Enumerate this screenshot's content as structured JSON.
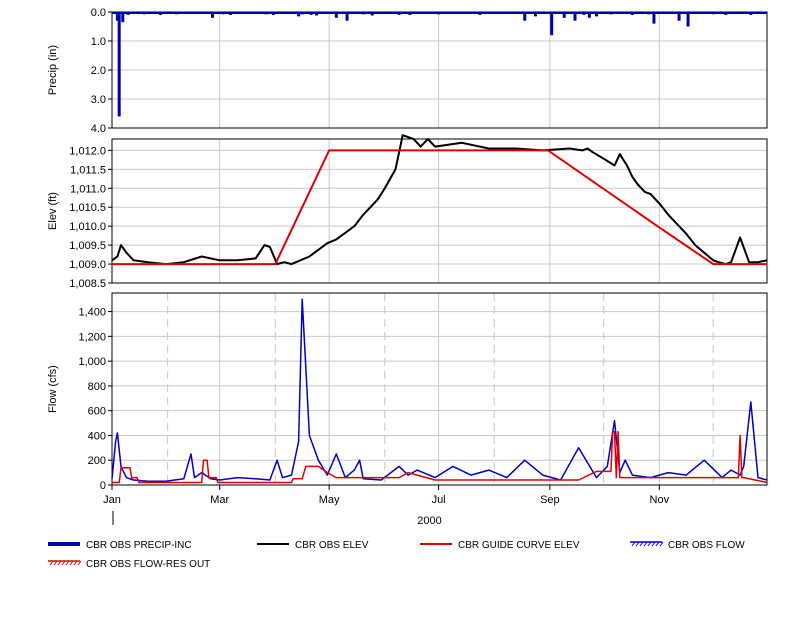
{
  "chart_data": [
    {
      "type": "bar",
      "panel": "precip",
      "ylabel": "Precip (in)",
      "y_inverted": true,
      "ylim": [
        4.0,
        0.0
      ],
      "yticks": [
        "0.0",
        "1.0",
        "2.0",
        "3.0",
        "4.0"
      ],
      "ytick_values": [
        0,
        1,
        2,
        3,
        4
      ],
      "grid": true,
      "series": [
        {
          "name": "CBR OBS PRECIP-INC",
          "color": "#0000a8",
          "x_day_of_year": [
            3,
            4,
            6,
            9,
            14,
            18,
            21,
            24,
            27,
            32,
            36,
            38,
            40,
            44,
            49,
            51,
            56,
            62,
            66,
            70,
            75,
            80,
            86,
            90,
            95,
            101,
            104,
            106,
            111,
            114,
            121,
            125,
            131,
            135,
            140,
            145,
            150,
            155,
            160,
            166,
            171,
            176,
            182,
            187,
            192,
            198,
            205,
            212,
            218,
            225,
            230,
            236,
            240,
            245,
            252,
            258,
            263,
            266,
            270,
            274,
            278,
            282,
            286,
            290,
            294,
            299,
            302,
            306,
            311,
            316,
            321,
            325,
            330,
            335,
            338,
            342,
            347,
            351,
            356,
            360,
            364
          ],
          "values": [
            0.3,
            3.6,
            0.35,
            0.1,
            0.05,
            0.08,
            0.05,
            0.04,
            0.1,
            0.05,
            0.08,
            0.05,
            0.07,
            0.05,
            0.05,
            0.05,
            0.2,
            0.08,
            0.1,
            0.05,
            0.05,
            0.05,
            0.08,
            0.1,
            0.06,
            0.05,
            0.15,
            0.08,
            0.1,
            0.12,
            0.05,
            0.2,
            0.3,
            0.05,
            0.08,
            0.12,
            0.05,
            0.07,
            0.1,
            0.1,
            0.05,
            0.05,
            0.08,
            0.05,
            0.05,
            0.06,
            0.1,
            0.05,
            0.05,
            0.05,
            0.3,
            0.15,
            0.05,
            0.8,
            0.2,
            0.3,
            0.1,
            0.2,
            0.15,
            0.05,
            0.08,
            0.05,
            0.05,
            0.1,
            0.05,
            0.08,
            0.4,
            0.05,
            0.05,
            0.3,
            0.5,
            0.05,
            0.05,
            0.08,
            0.05,
            0.1,
            0.05,
            0.05,
            0.1,
            0.05,
            0.05
          ]
        }
      ]
    },
    {
      "type": "line",
      "panel": "elev",
      "ylabel": "Elev (ft)",
      "ylim": [
        1008.5,
        1012.3
      ],
      "yticks": [
        "1,008.5",
        "1,009.0",
        "1,009.5",
        "1,010.0",
        "1,010.5",
        "1,011.0",
        "1,011.5",
        "1,012.0"
      ],
      "ytick_values": [
        1008.5,
        1009.0,
        1009.5,
        1010.0,
        1010.5,
        1011.0,
        1011.5,
        1012.0
      ],
      "grid": true,
      "series": [
        {
          "name": "CBR OBS ELEV",
          "color": "#000000",
          "x_day_of_year": [
            0,
            3,
            5,
            8,
            12,
            20,
            30,
            40,
            50,
            60,
            70,
            80,
            85,
            88,
            92,
            96,
            100,
            110,
            120,
            125,
            135,
            140,
            148,
            152,
            158,
            162,
            168,
            172,
            176,
            180,
            195,
            210,
            225,
            240,
            255,
            262,
            265,
            268,
            275,
            280,
            283,
            287,
            290,
            293,
            297,
            300,
            305,
            310,
            315,
            320,
            325,
            330,
            335,
            338,
            342,
            345,
            350,
            355,
            360,
            365
          ],
          "values": [
            1009.1,
            1009.2,
            1009.5,
            1009.3,
            1009.1,
            1009.05,
            1009.0,
            1009.05,
            1009.2,
            1009.1,
            1009.1,
            1009.15,
            1009.5,
            1009.45,
            1009.0,
            1009.05,
            1009.0,
            1009.2,
            1009.55,
            1009.65,
            1010.0,
            1010.3,
            1010.7,
            1011.0,
            1011.5,
            1012.4,
            1012.3,
            1012.1,
            1012.3,
            1012.1,
            1012.2,
            1012.05,
            1012.05,
            1012.0,
            1012.05,
            1012.0,
            1012.05,
            1011.95,
            1011.75,
            1011.6,
            1011.9,
            1011.6,
            1011.3,
            1011.1,
            1010.9,
            1010.85,
            1010.6,
            1010.3,
            1010.05,
            1009.8,
            1009.5,
            1009.3,
            1009.1,
            1009.05,
            1009.0,
            1009.05,
            1009.7,
            1009.05,
            1009.05,
            1009.1
          ]
        },
        {
          "name": "CBR GUIDE CURVE ELEV",
          "color": "#e00000",
          "x_day_of_year": [
            0,
            75,
            91,
            121,
            243,
            304,
            335,
            365
          ],
          "values": [
            1009.0,
            1009.0,
            1009.0,
            1012.0,
            1012.0,
            1010.0,
            1009.0,
            1009.0
          ]
        }
      ]
    },
    {
      "type": "line",
      "panel": "flow",
      "ylabel": "Flow (cfs)",
      "ylim": [
        0,
        1550
      ],
      "yticks": [
        "0",
        "200",
        "400",
        "600",
        "800",
        "1,000",
        "1,200",
        "1,400"
      ],
      "ytick_values": [
        0,
        200,
        400,
        600,
        800,
        1000,
        1200,
        1400
      ],
      "grid": true,
      "x_months": [
        "Jan",
        "Mar",
        "May",
        "Jul",
        "Sep",
        "Nov"
      ],
      "x_month_day_of_year": [
        0,
        60,
        121,
        182,
        244,
        305
      ],
      "x_gridline_day_of_year": [
        31,
        91,
        152,
        213,
        274,
        335
      ],
      "year_label": "2000",
      "series": [
        {
          "name": "CBR OBS FLOW",
          "color": "#0000c8",
          "x_day_of_year": [
            0,
            2,
            3,
            5,
            8,
            12,
            20,
            30,
            40,
            44,
            46,
            50,
            52,
            55,
            60,
            70,
            80,
            88,
            92,
            95,
            100,
            104,
            106,
            110,
            115,
            120,
            125,
            130,
            135,
            138,
            140,
            150,
            160,
            165,
            170,
            180,
            190,
            200,
            210,
            220,
            230,
            240,
            250,
            260,
            270,
            276,
            280,
            283,
            286,
            290,
            300,
            310,
            320,
            330,
            340,
            345,
            350,
            352,
            356,
            360,
            365
          ],
          "values": [
            50,
            350,
            420,
            150,
            60,
            40,
            30,
            30,
            50,
            250,
            60,
            100,
            80,
            50,
            40,
            60,
            50,
            40,
            200,
            60,
            80,
            350,
            1500,
            400,
            200,
            80,
            250,
            60,
            120,
            200,
            50,
            40,
            150,
            80,
            120,
            60,
            150,
            80,
            120,
            60,
            200,
            80,
            40,
            300,
            60,
            150,
            520,
            100,
            200,
            80,
            60,
            100,
            80,
            200,
            60,
            120,
            80,
            150,
            670,
            60,
            40
          ]
        },
        {
          "name": "CBR OBS FLOW-RES OUT",
          "color": "#e00000",
          "x_day_of_year": [
            0,
            4,
            5,
            10,
            11,
            14,
            15,
            50,
            51,
            53,
            54,
            58,
            59,
            100,
            101,
            106,
            108,
            115,
            120,
            125,
            160,
            165,
            180,
            190,
            260,
            270,
            278,
            279,
            280,
            281,
            282,
            283,
            290,
            300,
            345,
            349,
            350,
            351,
            352,
            365
          ],
          "values": [
            20,
            20,
            140,
            140,
            60,
            60,
            20,
            20,
            200,
            200,
            60,
            60,
            20,
            20,
            50,
            50,
            150,
            150,
            100,
            60,
            60,
            100,
            40,
            40,
            40,
            110,
            110,
            430,
            430,
            60,
            430,
            60,
            60,
            60,
            60,
            60,
            400,
            60,
            60,
            20
          ]
        }
      ]
    }
  ],
  "legend": [
    {
      "name": "CBR OBS PRECIP-INC",
      "color": "#0000a8",
      "style": "thick"
    },
    {
      "name": "CBR OBS ELEV",
      "color": "#000000",
      "style": "line"
    },
    {
      "name": "CBR GUIDE CURVE ELEV",
      "color": "#e00000",
      "style": "line"
    },
    {
      "name": "CBR OBS FLOW",
      "color": "#0000c8",
      "style": "hatch"
    },
    {
      "name": "CBR OBS FLOW-RES OUT",
      "color": "#e00000",
      "style": "hatch"
    }
  ]
}
